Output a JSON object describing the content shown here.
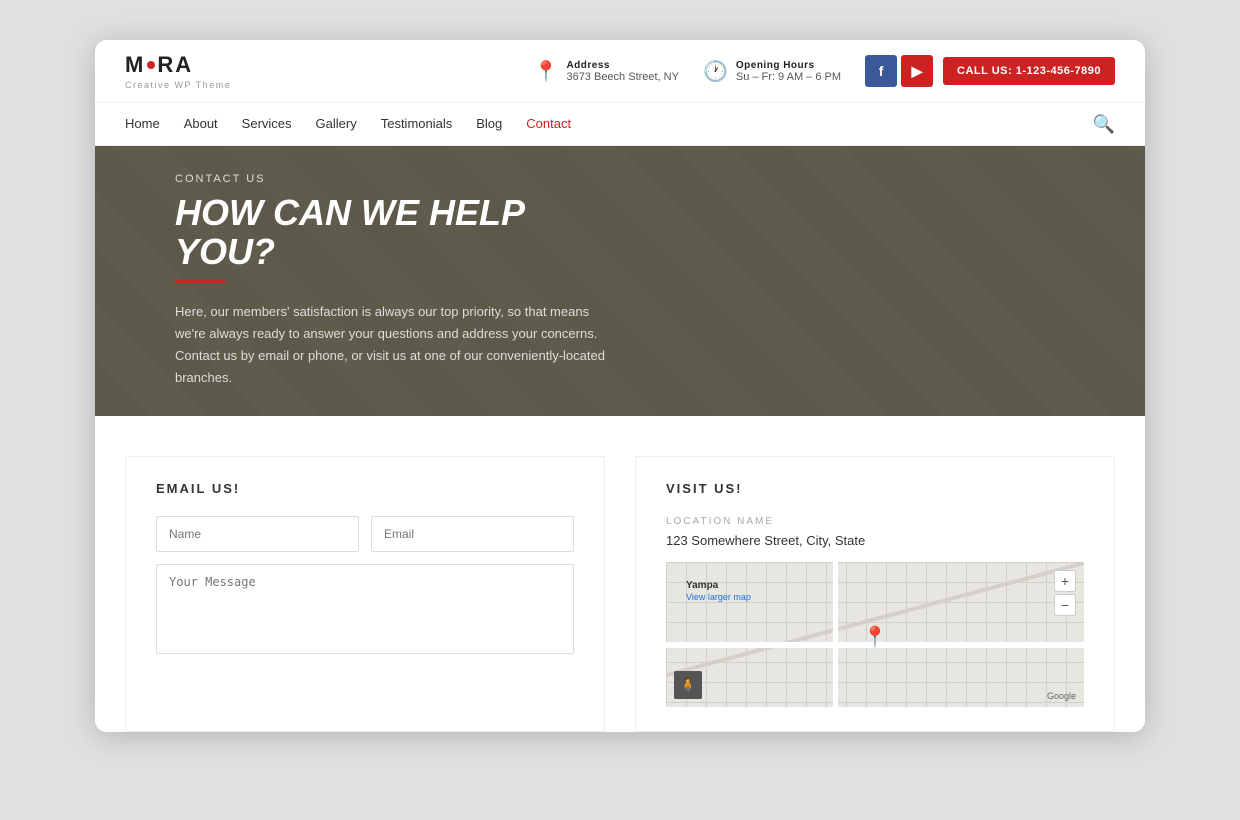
{
  "logo": {
    "text_before": "M",
    "text_after": "RA",
    "dot": "●",
    "subtitle": "Creative WP Theme"
  },
  "header": {
    "address_label": "Address",
    "address_value": "3673 Beech Street, NY",
    "hours_label": "Opening Hours",
    "hours_value": "Su – Fr: 9 AM – 6 PM",
    "cta_label": "CALL US: 1-123-456-7890"
  },
  "nav": {
    "links": [
      {
        "label": "Home",
        "active": false
      },
      {
        "label": "About",
        "active": false
      },
      {
        "label": "Services",
        "active": false
      },
      {
        "label": "Gallery",
        "active": false
      },
      {
        "label": "Testimonials",
        "active": false
      },
      {
        "label": "Blog",
        "active": false
      },
      {
        "label": "Contact",
        "active": true
      }
    ]
  },
  "hero": {
    "label": "CONTACT US",
    "title": "HOW CAN WE HELP YOU?",
    "description": "Here, our members' satisfaction is always our top priority, so that means we're always ready to answer your questions and address your concerns. Contact us by email or phone, or visit us at one of our conveniently-located branches."
  },
  "email_section": {
    "title": "EMAIL US!",
    "name_placeholder": "Name",
    "email_placeholder": "Email",
    "message_placeholder": "Your Message"
  },
  "visit_section": {
    "title": "VISIT US!",
    "location_label": "LOCATION NAME",
    "address": "123 Somewhere Street, City, State",
    "map": {
      "label": "Yampa",
      "view_link": "View larger map",
      "zoom_in": "+",
      "zoom_out": "−",
      "google": "Google"
    }
  },
  "colors": {
    "accent": "#cc2222",
    "facebook": "#3b5998",
    "youtube": "#cc2222"
  }
}
